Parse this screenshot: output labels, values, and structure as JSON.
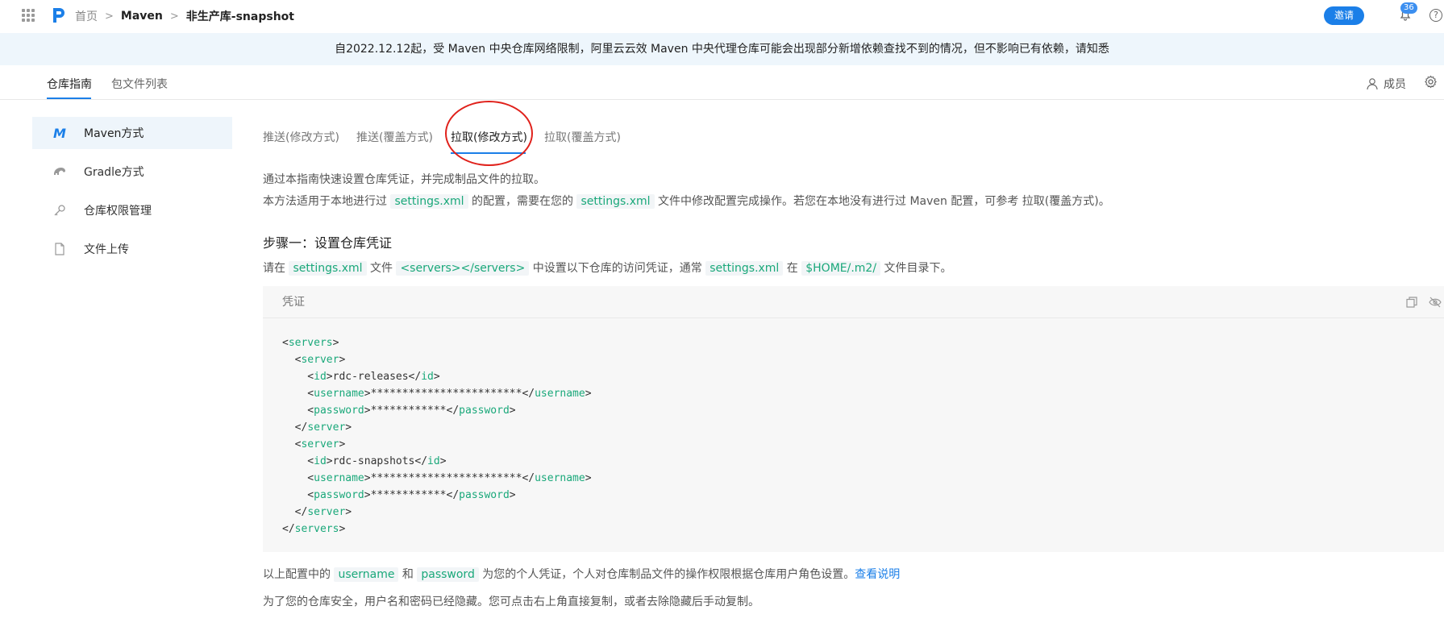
{
  "breadcrumb": {
    "home": "首页",
    "maven": "Maven",
    "repo": "非生产库-snapshot"
  },
  "header": {
    "invite": "邀请",
    "notify_count": "36"
  },
  "notice": "自2022.12.12起，受 Maven 中央仓库网络限制，阿里云云效 Maven 中央代理仓库可能会出现部分新增依赖查找不到的情况，但不影响已有依赖，请知悉",
  "subtabs": [
    "仓库指南",
    "包文件列表"
  ],
  "members": "成员",
  "sidebar": [
    {
      "icon": "M",
      "label": "Maven方式"
    },
    {
      "label": "Gradle方式"
    },
    {
      "label": "仓库权限管理"
    },
    {
      "label": "文件上传"
    }
  ],
  "tabs": [
    "推送(修改方式)",
    "推送(覆盖方式)",
    "拉取(修改方式)",
    "拉取(覆盖方式)"
  ],
  "intro": {
    "line1": "通过本指南快速设置仓库凭证，并完成制品文件的拉取。",
    "line2_a": "本方法适用于本地进行过",
    "line2_code1": "settings.xml",
    "line2_b": "的配置，需要在您的",
    "line2_code2": "settings.xml",
    "line2_c": "文件中修改配置完成操作。若您在本地没有进行过 Maven 配置，可参考 拉取(覆盖方式)。"
  },
  "step1": {
    "title": "步骤一：设置仓库凭证",
    "desc_a": "请在",
    "desc_code1": "settings.xml",
    "desc_b": "文件",
    "desc_code2": "<servers></servers>",
    "desc_c": "中设置以下仓库的访问凭证，通常",
    "desc_code3": "settings.xml",
    "desc_d": "在",
    "desc_code4": "$HOME/.m2/",
    "desc_e": "文件目录下。"
  },
  "cred_box": {
    "title": "凭证",
    "code": {
      "servers_open": "servers",
      "server_tag": "server",
      "id_tag": "id",
      "username_tag": "username",
      "password_tag": "password",
      "id1": "rdc-releases",
      "id2": "rdc-snapshots",
      "username_mask": "************************",
      "password_mask": "************"
    }
  },
  "footer": {
    "line1_a": "以上配置中的",
    "line1_code1": "username",
    "line1_b": "和",
    "line1_code2": "password",
    "line1_c": "为您的个人凭证，个人对仓库制品文件的操作权限根据仓库用户角色设置。",
    "line1_link": "查看说明",
    "line2": "为了您的仓库安全，用户名和密码已经隐藏。您可点击右上角直接复制，或者去除隐藏后手动复制。"
  },
  "colors": {
    "accent": "#1b7fe8",
    "code_green": "#1aa87a",
    "annotation_red": "#e0211b"
  }
}
